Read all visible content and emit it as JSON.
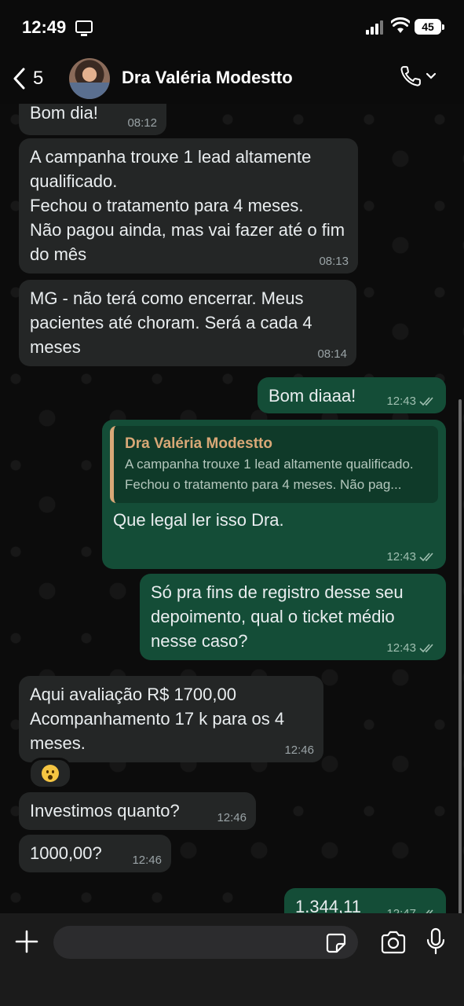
{
  "status_bar": {
    "time": "12:49",
    "battery": "45"
  },
  "header": {
    "back_count": "5",
    "contact_name": "Dra Valéria Modestto"
  },
  "messages": [
    {
      "dir": "in",
      "text": "Bom dia!",
      "time": "08:12"
    },
    {
      "dir": "in",
      "text": "A campanha trouxe 1 lead altamente qualificado.\nFechou o tratamento para 4 meses.\nNão pagou ainda, mas vai fazer até o fim do mês",
      "time": "08:13"
    },
    {
      "dir": "in",
      "text": "MG - não terá como encerrar. Meus pacientes até choram. Será a cada 4 meses",
      "time": "08:14"
    },
    {
      "dir": "out",
      "text": "Bom diaaa!",
      "time": "12:43"
    },
    {
      "dir": "out",
      "quote_name": "Dra Valéria Modestto",
      "quote_text": "A campanha trouxe 1 lead altamente qualificado.\nFechou o tratamento para 4 meses. Não pag...",
      "text": "Que legal ler isso Dra.",
      "time": "12:43"
    },
    {
      "dir": "out",
      "text": "Só pra fins de registro desse seu depoimento, qual o ticket médio nesse caso?",
      "time": "12:43"
    },
    {
      "dir": "in",
      "text": "Aqui avaliação R$ 1700,00\nAcompanhamento 17 k para os 4 meses.",
      "time": "12:46"
    },
    {
      "dir": "in",
      "text": "Investimos quanto?",
      "time": "12:46"
    },
    {
      "dir": "in",
      "text": "1000,00?",
      "time": "12:46"
    },
    {
      "dir": "out",
      "text": "1.344,11",
      "time": "12:47"
    }
  ],
  "reaction": {
    "emoji_name": "astonished-face-emoji"
  },
  "composer": {
    "placeholder": ""
  },
  "colors": {
    "incoming": "#242626",
    "outgoing": "#144d37",
    "quote_accent": "#d9a877"
  }
}
